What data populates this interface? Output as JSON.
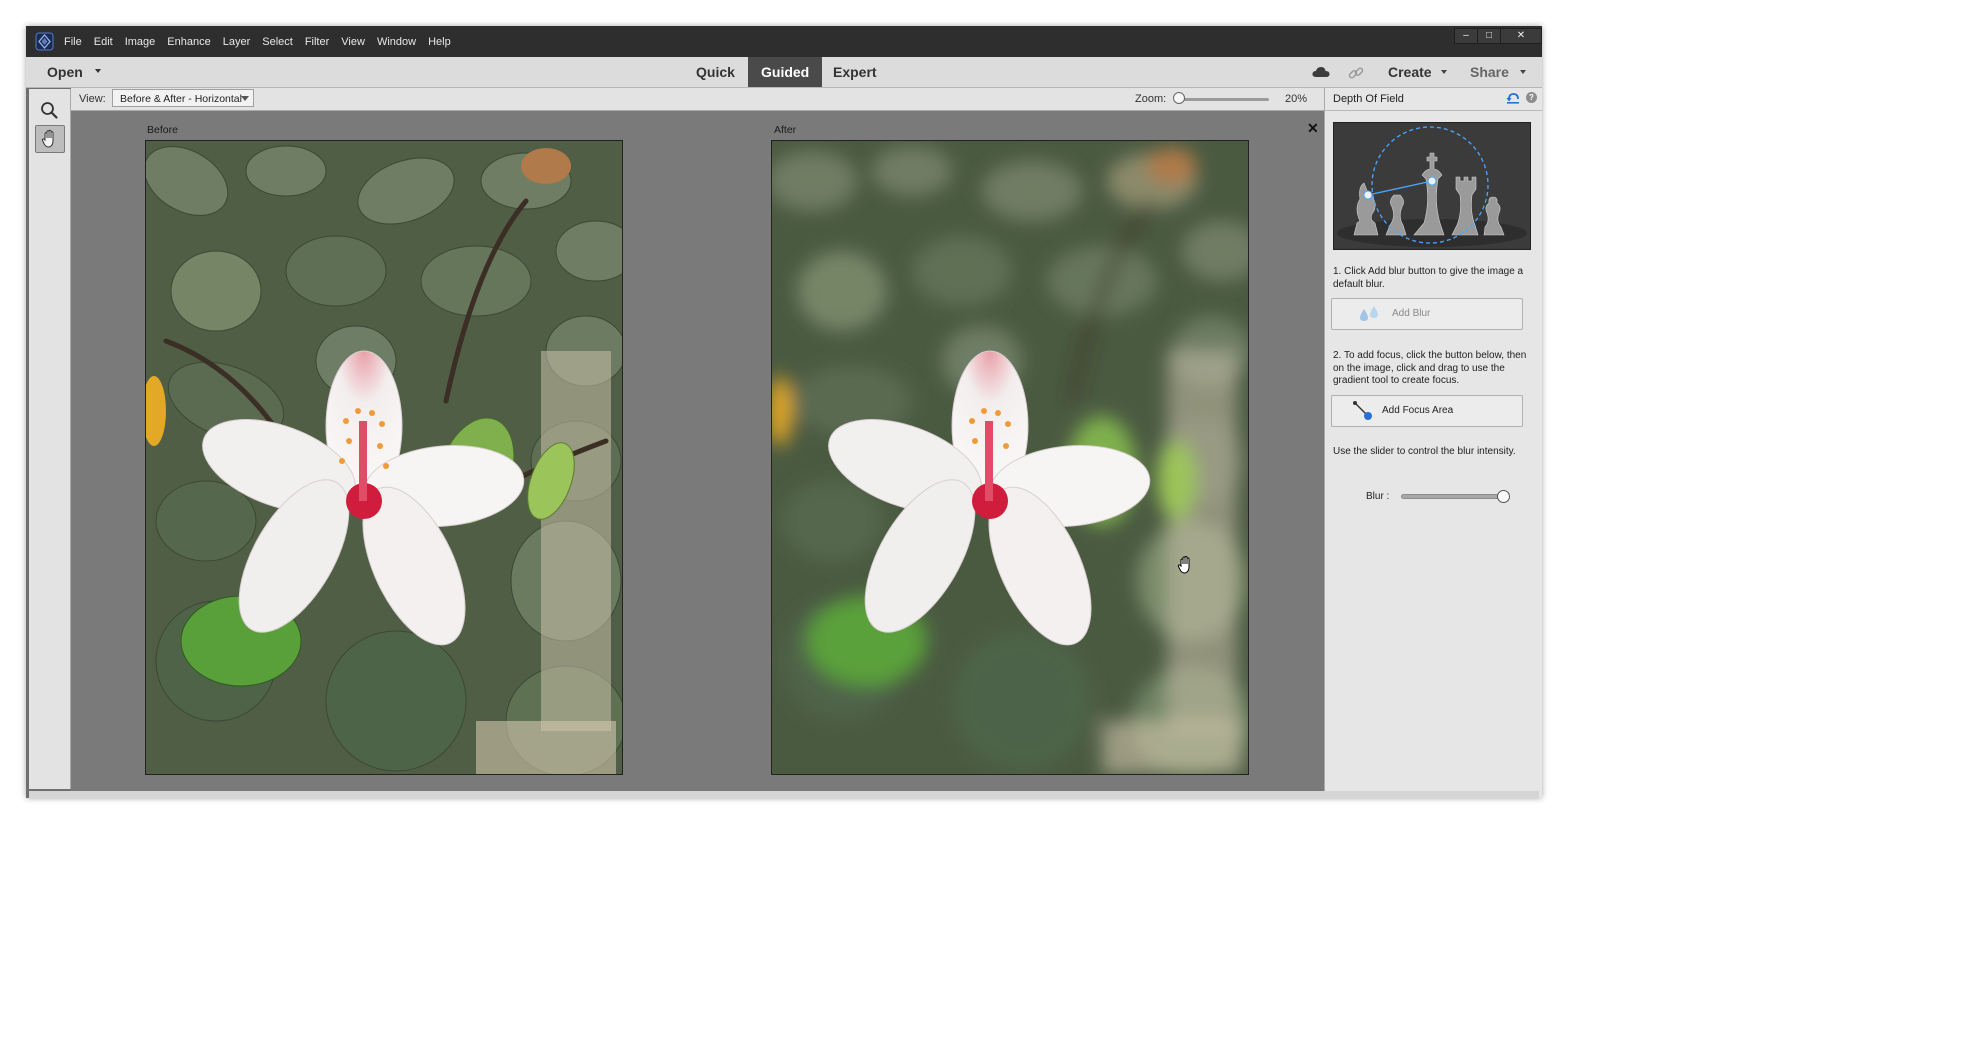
{
  "menu": [
    "File",
    "Edit",
    "Image",
    "Enhance",
    "Layer",
    "Select",
    "Filter",
    "View",
    "Window",
    "Help"
  ],
  "window_controls": [
    "–",
    "□",
    "✕"
  ],
  "modebar": {
    "open_label": "Open",
    "tabs": [
      {
        "label": "Quick",
        "active": false
      },
      {
        "label": "Guided",
        "active": true
      },
      {
        "label": "Expert",
        "active": false
      }
    ],
    "create_label": "Create",
    "share_label": "Share",
    "icons": [
      "cloud-icon",
      "link-icon"
    ]
  },
  "toolbox": {
    "tools": [
      "zoom-icon",
      "hand-icon"
    ],
    "active_tool": "hand-icon"
  },
  "viewbar": {
    "view_label": "View:",
    "view_value": "Before & After - Horizontal",
    "zoom_label": "Zoom:",
    "zoom_value": "20%"
  },
  "canvas": {
    "before_label": "Before",
    "after_label": "After",
    "close_glyph": "✕"
  },
  "panel": {
    "title": "Depth Of Field",
    "step1": "1. Click Add blur button to give the image a default blur.",
    "add_blur_label": "Add Blur",
    "step2": "2. To add focus, click the button below, then on the image, click and drag to use the gradient tool to create focus.",
    "add_focus_label": "Add Focus Area",
    "slider_hint": "Use the slider to control the blur intensity.",
    "blur_label": "Blur :",
    "blur_level": 1.0
  },
  "colors": {
    "titlebar": "#2e2e2e",
    "active_tab": "#4a4a4a",
    "canvas": "#7a7a7a",
    "panel": "#e6e6e6",
    "accent": "#2a6fd6"
  }
}
